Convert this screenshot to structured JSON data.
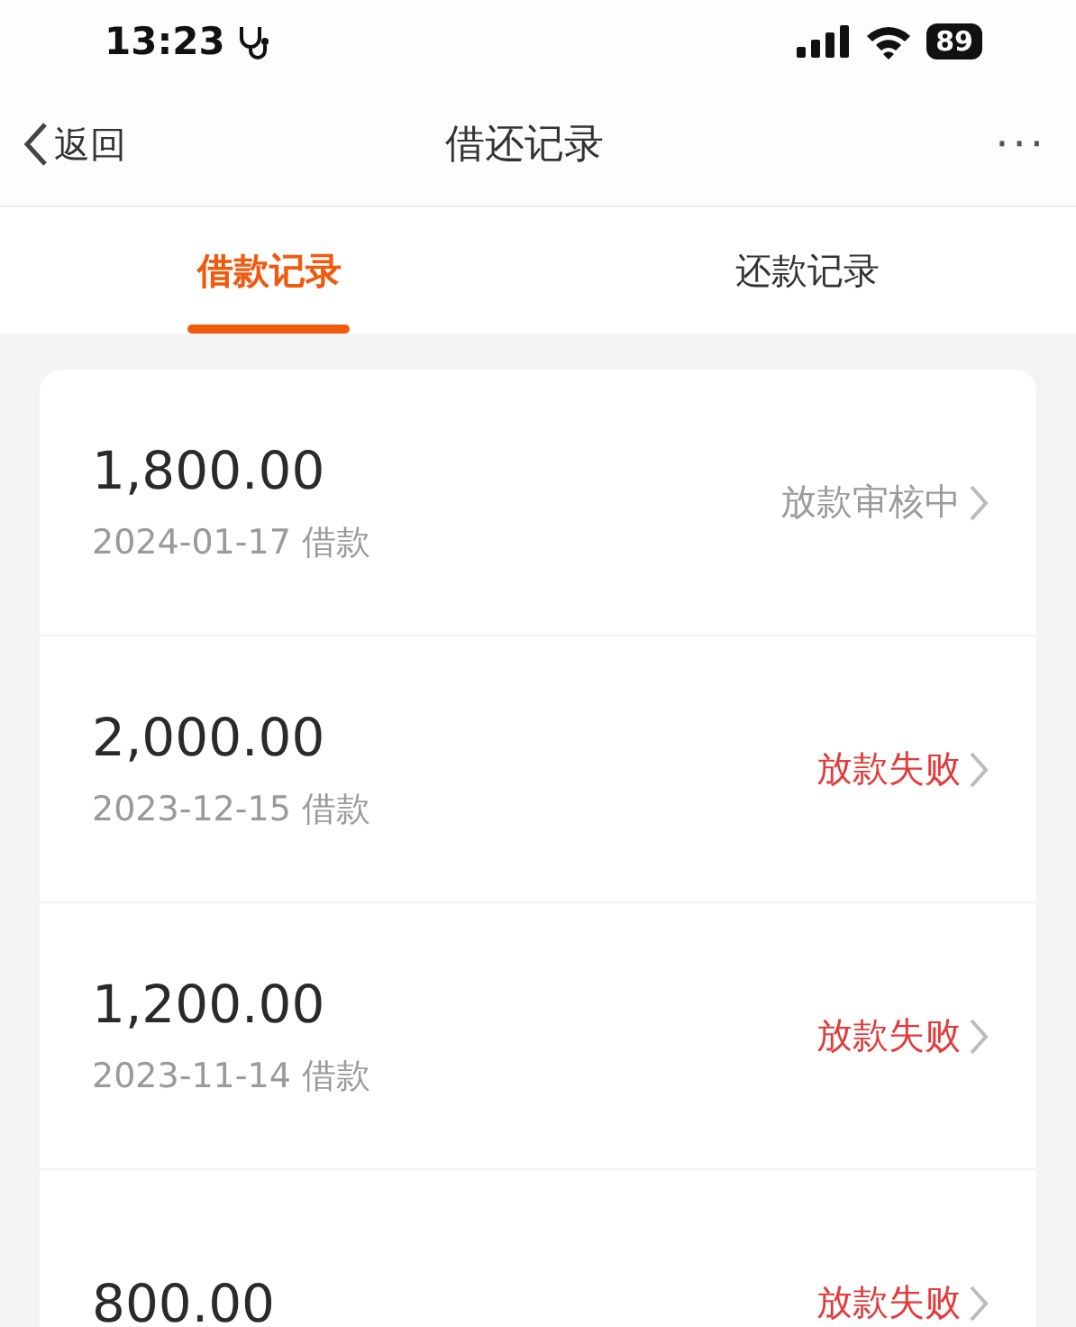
{
  "status_bar": {
    "time": "13:23",
    "battery": "89"
  },
  "nav": {
    "back": "返回",
    "title": "借还记录",
    "more": "···"
  },
  "tabs": [
    {
      "label": "借款记录",
      "selected": true
    },
    {
      "label": "还款记录",
      "selected": false
    }
  ],
  "records": [
    {
      "amount": "1,800.00",
      "date": "2024-01-17 借款",
      "status": "放款审核中",
      "kind": "pending"
    },
    {
      "amount": "2,000.00",
      "date": "2023-12-15 借款",
      "status": "放款失败",
      "kind": "failed"
    },
    {
      "amount": "1,200.00",
      "date": "2023-11-14 借款",
      "status": "放款失败",
      "kind": "failed"
    },
    {
      "amount": "800.00",
      "status": "放款失败",
      "kind": "failed"
    }
  ]
}
